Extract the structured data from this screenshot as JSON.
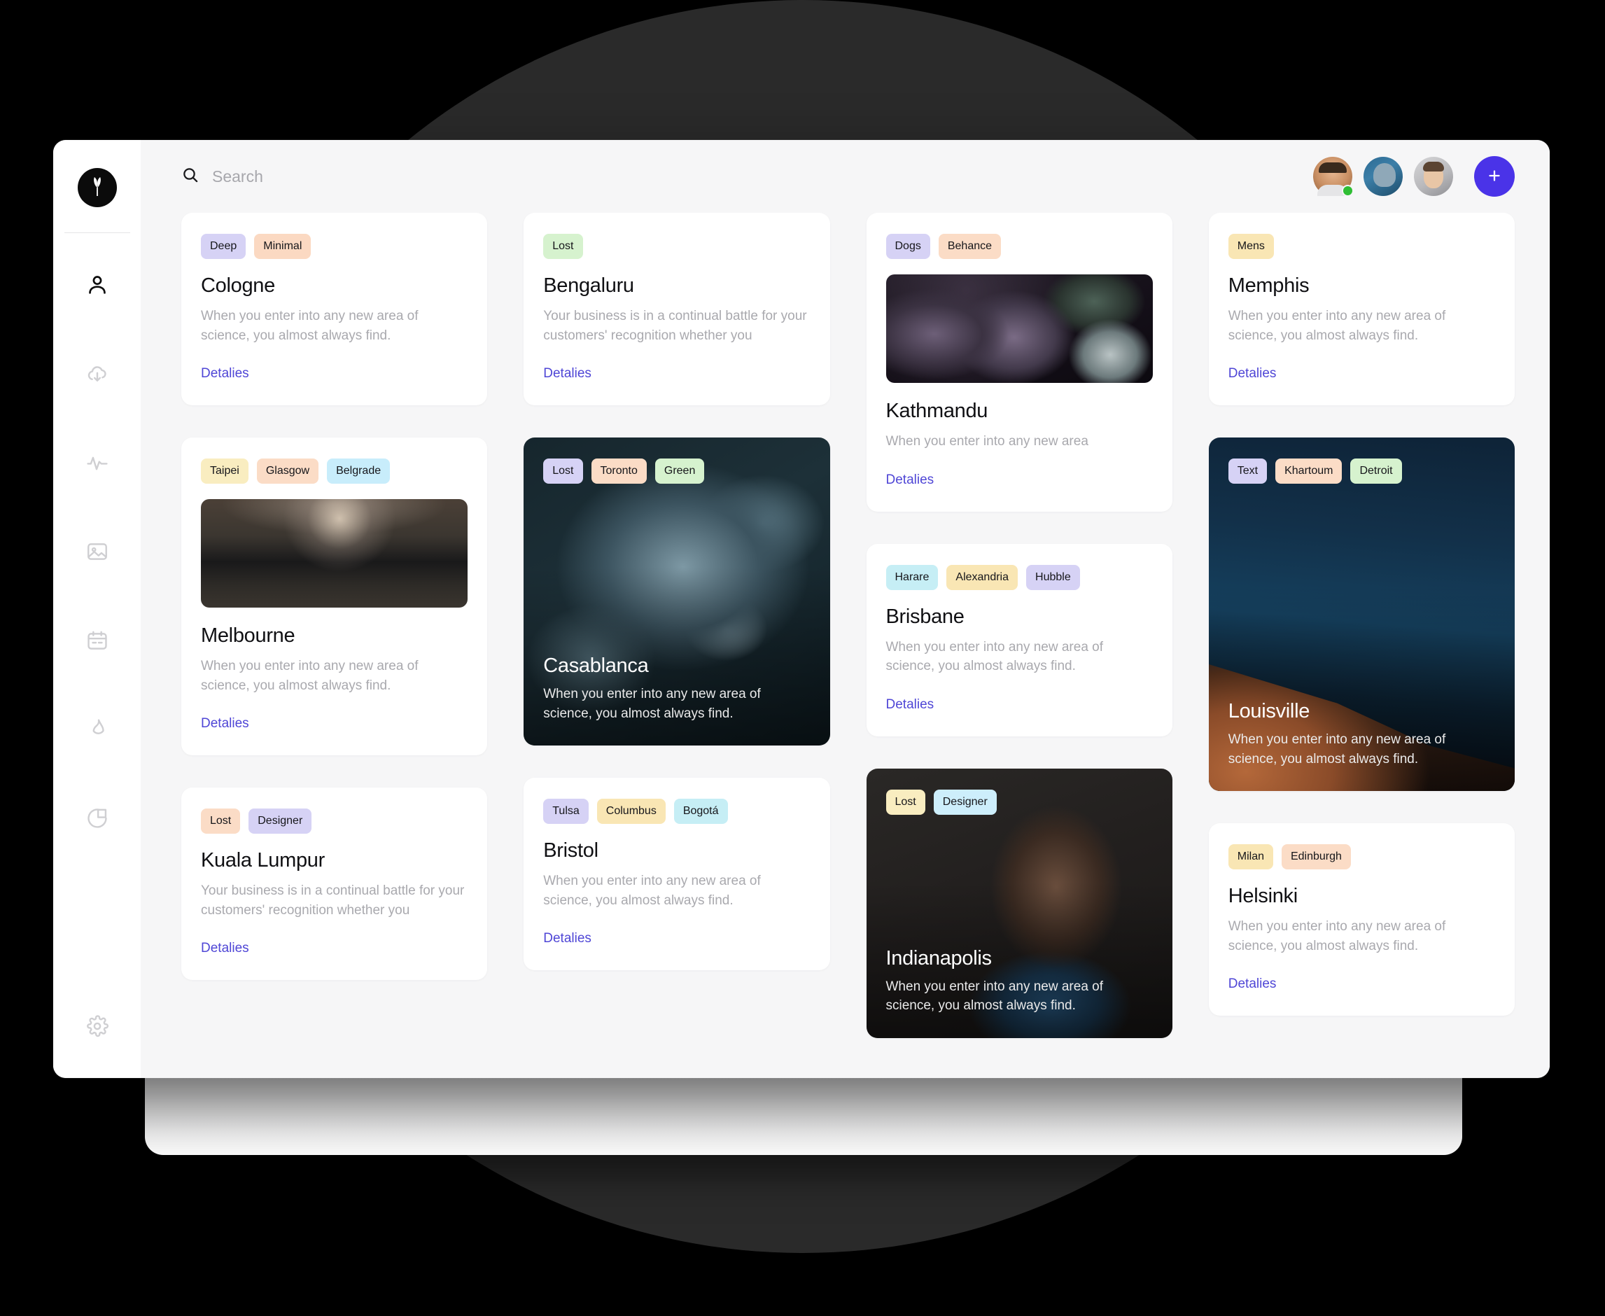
{
  "brand": {
    "logo_icon": "leaf-logo-icon"
  },
  "sidebar": {
    "items": [
      {
        "icon": "user-icon",
        "name": "sidebar-item-profile",
        "active": true
      },
      {
        "icon": "cloud-download-icon",
        "name": "sidebar-item-downloads",
        "active": false
      },
      {
        "icon": "activity-pulse-icon",
        "name": "sidebar-item-activity",
        "active": false
      },
      {
        "icon": "image-icon",
        "name": "sidebar-item-gallery",
        "active": false
      },
      {
        "icon": "calendar-icon",
        "name": "sidebar-item-calendar",
        "active": false
      },
      {
        "icon": "flame-icon",
        "name": "sidebar-item-trending",
        "active": false
      },
      {
        "icon": "pie-chart-icon",
        "name": "sidebar-item-analytics",
        "active": false
      }
    ],
    "settings": {
      "icon": "gear-icon",
      "name": "sidebar-item-settings"
    }
  },
  "topbar": {
    "search": {
      "placeholder": "Search",
      "value": "",
      "icon": "search-icon"
    },
    "avatars": [
      {
        "name": "avatar-user-1",
        "online": true
      },
      {
        "name": "avatar-user-2",
        "online": false
      },
      {
        "name": "avatar-user-3",
        "online": false
      }
    ],
    "add_button": {
      "label": "+",
      "icon": "plus-icon",
      "color": "#4a33e8"
    }
  },
  "colors": {
    "accent": "#4a33e8",
    "link": "#4f46d6",
    "online": "#2fbe34",
    "tag_lavender": "#d6d2f5",
    "tag_peach": "#fbd9c2",
    "tag_green": "#d6f2ce",
    "tag_yellow": "#faecb8",
    "tag_cyan": "#c6eef5",
    "tag_blue": "#cdeefb",
    "tag_lightpeach": "#fbe0cf",
    "tag_lightyellow": "#f9edc0"
  },
  "cards": [
    {
      "name": "card-cologne",
      "column": 1,
      "style": "plain",
      "title": "Cologne",
      "description": "When you enter into any new area of science, you almost always find.",
      "link": "Detalies",
      "tags": [
        {
          "label": "Deep",
          "color": "#d6d2f5"
        },
        {
          "label": "Minimal",
          "color": "#fbd9c2"
        }
      ]
    },
    {
      "name": "card-melbourne",
      "column": 1,
      "style": "thumb",
      "title": "Melbourne",
      "description": "When you enter into any new area of science, you almost always find.",
      "link": "Detalies",
      "image": "milkyway-forest",
      "tags": [
        {
          "label": "Taipei",
          "color": "#f9edc0"
        },
        {
          "label": "Glasgow",
          "color": "#fbdcc6"
        },
        {
          "label": "Belgrade",
          "color": "#c8edfb"
        }
      ]
    },
    {
      "name": "card-kuala-lumpur",
      "column": 1,
      "style": "plain",
      "title": "Kuala Lumpur",
      "description": "Your business is in a continual battle for your customers' recognition whether you",
      "link": "Detalies",
      "tags": [
        {
          "label": "Lost",
          "color": "#fbdcc6"
        },
        {
          "label": "Designer",
          "color": "#d6d2f5"
        }
      ]
    },
    {
      "name": "card-bengaluru",
      "column": 2,
      "style": "plain",
      "title": "Bengaluru",
      "description": "Your business is in a continual battle for your customers' recognition whether you",
      "link": "Detalies",
      "tags": [
        {
          "label": "Lost",
          "color": "#d6f2ce"
        }
      ]
    },
    {
      "name": "card-casablanca",
      "column": 2,
      "style": "media",
      "title": "Casablanca",
      "description": "When you enter into any new area of science, you almost always find.",
      "image": "casablanca-texture",
      "tags": [
        {
          "label": "Lost",
          "color": "#d6d2f5"
        },
        {
          "label": "Toronto",
          "color": "#fbdcc6"
        },
        {
          "label": "Green",
          "color": "#d6f2ce"
        }
      ]
    },
    {
      "name": "card-bristol",
      "column": 2,
      "style": "plain",
      "title": "Bristol",
      "description": "When you enter into any new area of science, you almost always find.",
      "link": "Detalies",
      "tags": [
        {
          "label": "Tulsa",
          "color": "#d6d2f5"
        },
        {
          "label": "Columbus",
          "color": "#f9e6b4"
        },
        {
          "label": "Bogotá",
          "color": "#c6eef5"
        }
      ]
    },
    {
      "name": "card-kathmandu",
      "column": 3,
      "style": "thumb",
      "title": "Kathmandu",
      "description": "When you enter into any new area",
      "link": "Detalies",
      "image": "succulents",
      "tags": [
        {
          "label": "Dogs",
          "color": "#d6d2f5"
        },
        {
          "label": "Behance",
          "color": "#fbdcc6"
        }
      ]
    },
    {
      "name": "card-brisbane",
      "column": 3,
      "style": "plain",
      "title": "Brisbane",
      "description": "When you enter into any new area of science, you almost always find.",
      "link": "Detalies",
      "tags": [
        {
          "label": "Harare",
          "color": "#c6eef5"
        },
        {
          "label": "Alexandria",
          "color": "#f9e6b4"
        },
        {
          "label": "Hubble",
          "color": "#d6d2f5"
        }
      ]
    },
    {
      "name": "card-indianapolis",
      "column": 3,
      "style": "media",
      "title": "Indianapolis",
      "description": "When you enter into any new area of science, you almost always find.",
      "image": "portrait-blue-jacket",
      "tags": [
        {
          "label": "Lost",
          "color": "#f9edc0"
        },
        {
          "label": "Designer",
          "color": "#cdeefb"
        }
      ]
    },
    {
      "name": "card-memphis",
      "column": 4,
      "style": "plain",
      "title": "Memphis",
      "description": "When you enter into any new area of science, you almost always find.",
      "link": "Detalies",
      "tags": [
        {
          "label": "Mens",
          "color": "#f9e6b4"
        }
      ]
    },
    {
      "name": "card-louisville",
      "column": 4,
      "style": "media",
      "title": "Louisville",
      "description": "When you enter into any new area of science, you almost always find.",
      "image": "night-sky-canyon",
      "tags": [
        {
          "label": "Text",
          "color": "#d6d2f5"
        },
        {
          "label": "Khartoum",
          "color": "#fbdcc6"
        },
        {
          "label": "Detroit",
          "color": "#d6f2ce"
        }
      ]
    },
    {
      "name": "card-helsinki",
      "column": 4,
      "style": "plain",
      "title": "Helsinki",
      "description": "When you enter into any new area of science, you almost always find.",
      "link": "Detalies",
      "tags": [
        {
          "label": "Milan",
          "color": "#f9e6b4"
        },
        {
          "label": "Edinburgh",
          "color": "#fbdcc6"
        }
      ]
    }
  ]
}
